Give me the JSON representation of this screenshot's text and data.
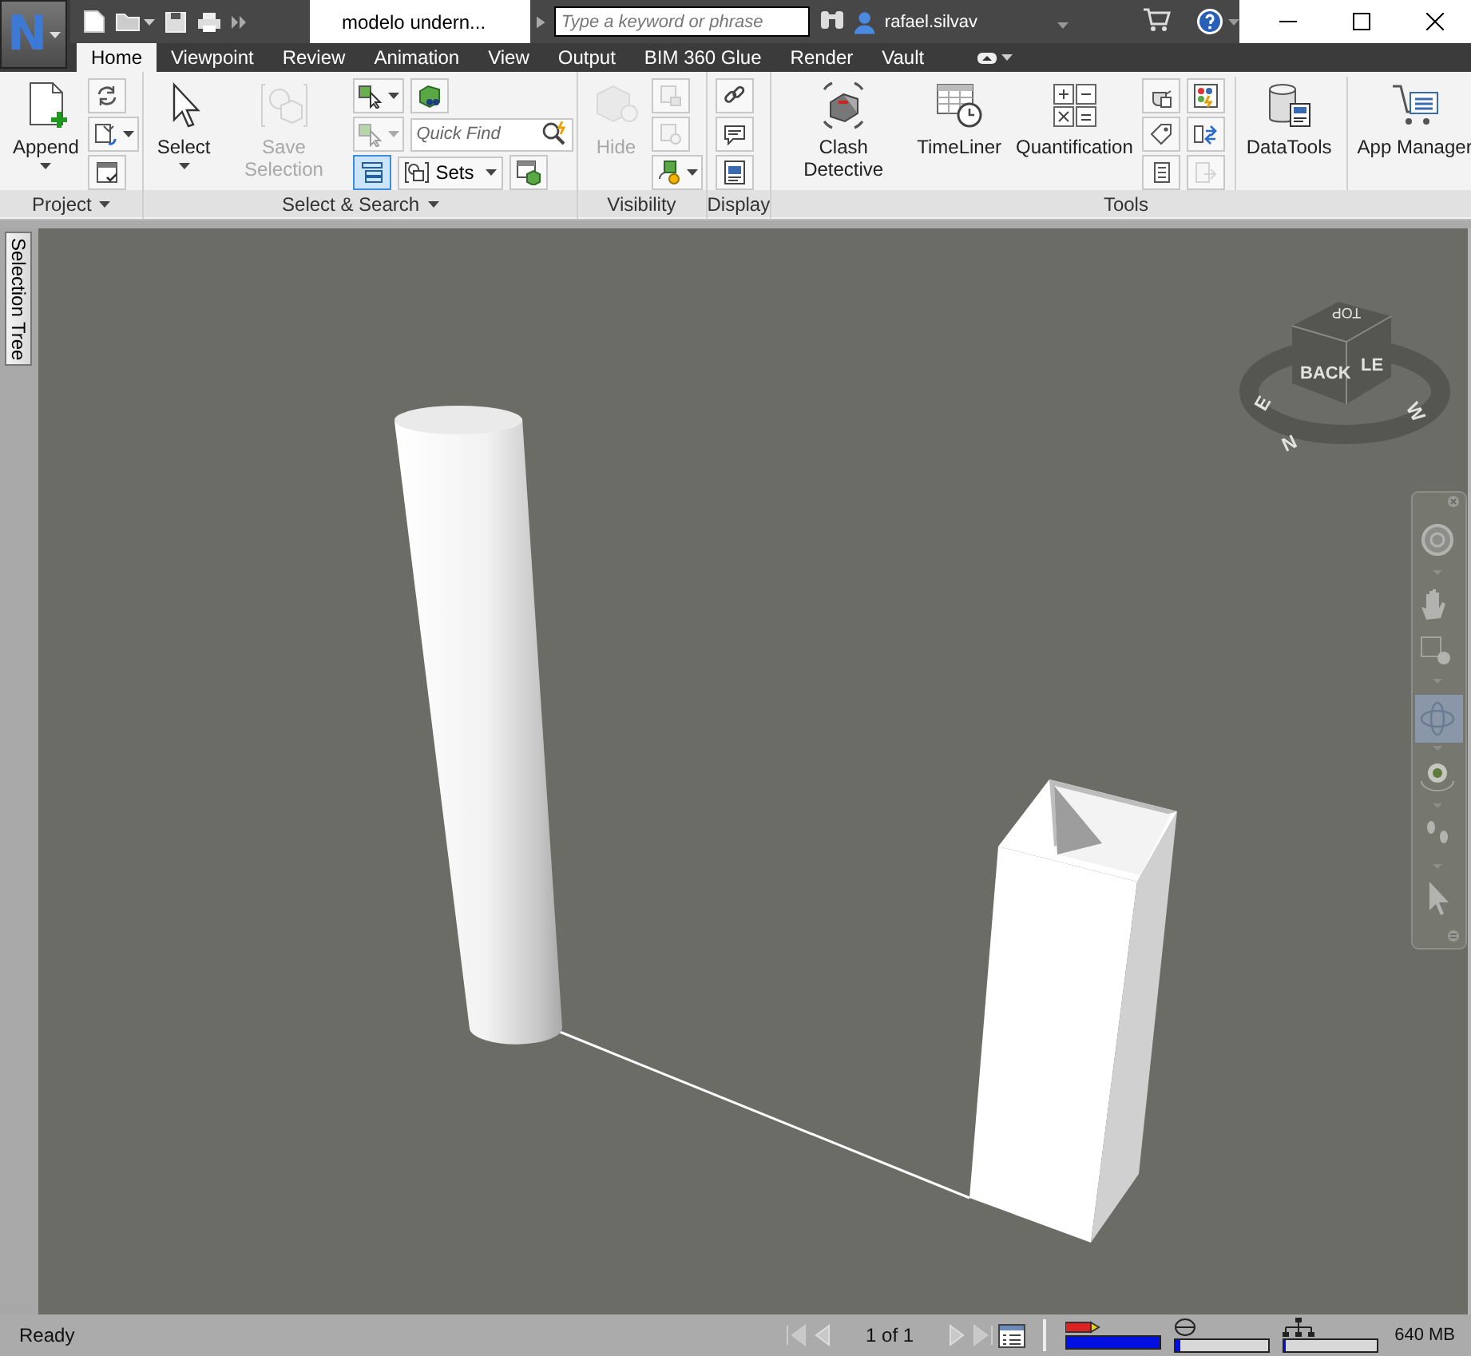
{
  "app_button": {
    "letter": "N"
  },
  "title_bar": {
    "document_title": "modelo undern...",
    "search": {
      "placeholder": "Type a keyword or phrase"
    },
    "user_name": "rafael.silvav"
  },
  "ribbon_tabs": [
    {
      "label": "Home",
      "selected": true
    },
    {
      "label": "Viewpoint",
      "selected": false
    },
    {
      "label": "Review",
      "selected": false
    },
    {
      "label": "Animation",
      "selected": false
    },
    {
      "label": "View",
      "selected": false
    },
    {
      "label": "Output",
      "selected": false
    },
    {
      "label": "BIM 360 Glue",
      "selected": false
    },
    {
      "label": "Render",
      "selected": false
    },
    {
      "label": "Vault",
      "selected": false
    }
  ],
  "ribbon_panels": [
    {
      "title": "Project",
      "has_menu": true,
      "groups": [
        {
          "kind": "large",
          "label": "Append",
          "disabled": false,
          "has_menu": true
        },
        {
          "kind": "stack",
          "rows": [
            [
              {
                "kind": "icon",
                "disabled": false,
                "on": false,
                "split": false
              }
            ],
            [
              {
                "kind": "icon",
                "disabled": false,
                "on": false,
                "split": true
              }
            ],
            [
              {
                "kind": "icon",
                "disabled": false,
                "on": false,
                "split": false
              }
            ]
          ]
        }
      ]
    },
    {
      "title": "Select & Search",
      "has_menu": true,
      "groups": [
        {
          "kind": "large",
          "label": "Select",
          "disabled": false,
          "has_menu": true
        },
        {
          "kind": "large",
          "label": "Save Selection",
          "disabled": true,
          "has_menu": false
        },
        {
          "kind": "stack",
          "rows": [
            [
              {
                "kind": "icon",
                "disabled": false,
                "on": false,
                "split": true
              },
              {
                "kind": "icon",
                "disabled": false,
                "on": false,
                "split": false
              }
            ],
            [
              {
                "kind": "icon",
                "disabled": true,
                "on": false,
                "split": true
              },
              {
                "kind": "field",
                "placeholder": "Quick Find"
              }
            ],
            [
              {
                "kind": "icon",
                "disabled": false,
                "on": true,
                "split": false
              },
              {
                "kind": "dropdown",
                "label": "Sets"
              },
              {
                "kind": "icon",
                "disabled": false,
                "on": false,
                "split": false
              }
            ]
          ]
        }
      ]
    },
    {
      "title": "Visibility",
      "has_menu": false,
      "groups": [
        {
          "kind": "large",
          "label": "Hide",
          "disabled": true,
          "has_menu": false
        },
        {
          "kind": "stack",
          "rows": [
            [
              {
                "kind": "icon",
                "disabled": true,
                "on": false,
                "split": false
              }
            ],
            [
              {
                "kind": "icon",
                "disabled": true,
                "on": false,
                "split": false
              }
            ],
            [
              {
                "kind": "icon",
                "disabled": false,
                "on": false,
                "split": true
              }
            ]
          ]
        }
      ]
    },
    {
      "title": "Display",
      "has_menu": false,
      "groups": [
        {
          "kind": "stack",
          "rows": [
            [
              {
                "kind": "icon",
                "disabled": false,
                "on": false,
                "split": false
              }
            ],
            [
              {
                "kind": "icon",
                "disabled": false,
                "on": false,
                "split": false
              }
            ],
            [
              {
                "kind": "icon",
                "disabled": false,
                "on": false,
                "split": false
              }
            ]
          ]
        }
      ]
    },
    {
      "title": "Tools",
      "has_menu": false,
      "groups": [
        {
          "kind": "large",
          "label": "Clash Detective",
          "disabled": false,
          "has_menu": false,
          "divider_before": false
        },
        {
          "kind": "large",
          "label": "TimeLiner",
          "disabled": false,
          "has_menu": false,
          "divider_before": false
        },
        {
          "kind": "large",
          "label": "Quantification",
          "disabled": false,
          "has_menu": false,
          "divider_before": false
        },
        {
          "kind": "stack",
          "divider_before": false,
          "rows": [
            [
              {
                "kind": "icon",
                "disabled": false,
                "on": false,
                "split": false
              },
              {
                "kind": "icon",
                "disabled": false,
                "on": false,
                "split": false
              }
            ],
            [
              {
                "kind": "icon",
                "disabled": false,
                "on": false,
                "split": false
              },
              {
                "kind": "icon",
                "disabled": false,
                "on": false,
                "split": false
              }
            ],
            [
              {
                "kind": "icon",
                "disabled": false,
                "on": false,
                "split": false
              },
              {
                "kind": "icon",
                "disabled": true,
                "on": false,
                "split": false
              }
            ]
          ]
        },
        {
          "kind": "large",
          "label": "DataTools",
          "disabled": false,
          "has_menu": false,
          "divider_before": true
        },
        {
          "kind": "large",
          "label": "App Manager",
          "disabled": false,
          "has_menu": false,
          "divider_before": true
        }
      ]
    }
  ],
  "side_tabs": [
    {
      "label": "Selection Tree"
    }
  ],
  "view_cube": {
    "top": "TOP",
    "front": "BACK",
    "side": "LE",
    "compass": [
      "E",
      "N",
      "W"
    ]
  },
  "nav_tools": [
    {
      "selected": false
    },
    {
      "selected": false
    },
    {
      "selected": false
    },
    {
      "selected": true
    },
    {
      "selected": false
    },
    {
      "selected": false
    },
    {
      "selected": false
    }
  ],
  "status_bar": {
    "text": "Ready",
    "page_label": "1 of 1",
    "meters": [
      {
        "level": 1
      },
      {
        "level": 0.05
      },
      {
        "level": 0
      }
    ],
    "memory": "640 MB"
  }
}
